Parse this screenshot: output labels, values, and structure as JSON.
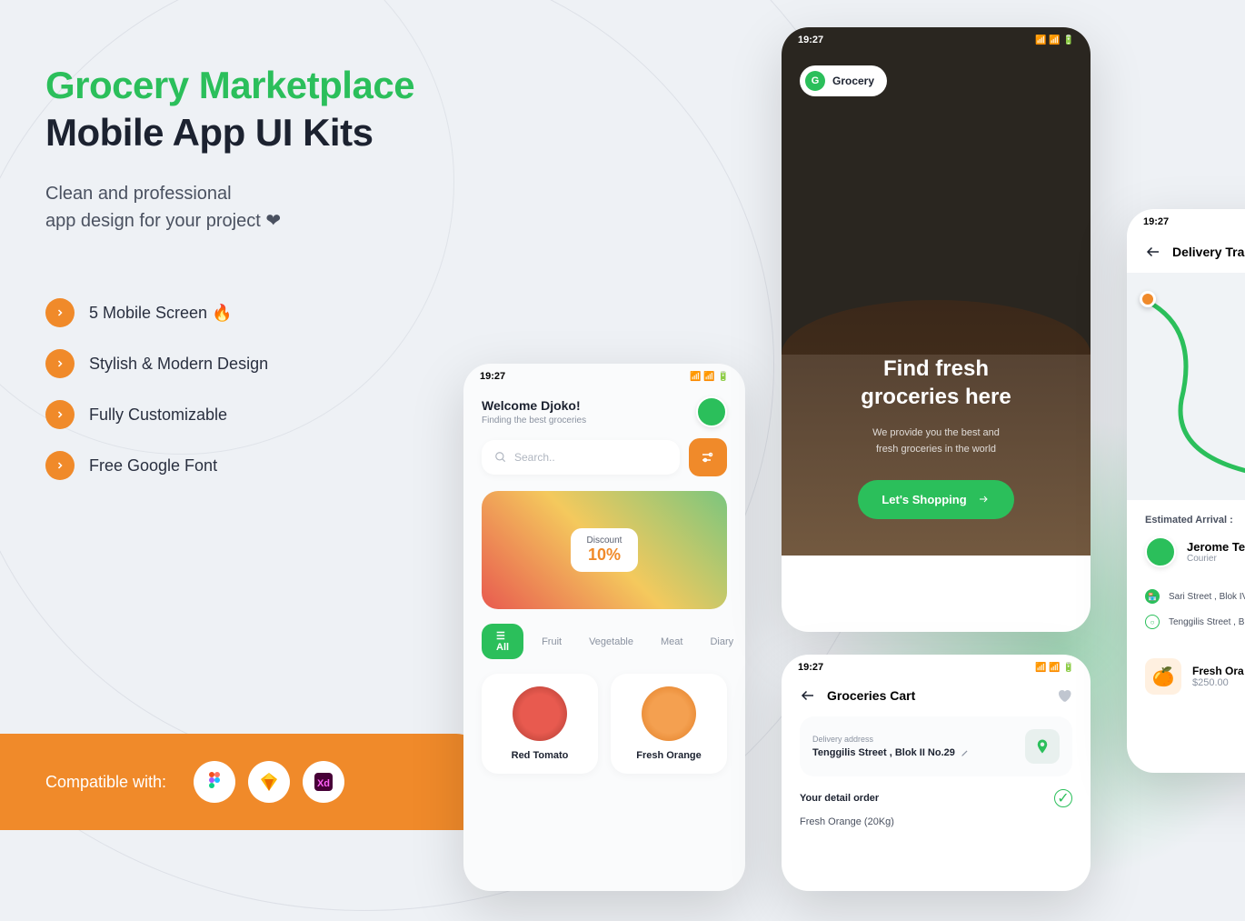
{
  "hero": {
    "title_green": "Grocery Marketplace",
    "title_dark": "Mobile App UI Kits",
    "subtitle_line1": "Clean and professional",
    "subtitle_line2": "app design for your project ❤"
  },
  "features": [
    {
      "text": "5 Mobile Screen 🔥"
    },
    {
      "text": "Stylish & Modern Design"
    },
    {
      "text": "Fully Customizable"
    },
    {
      "text": "Free Google Font"
    }
  ],
  "compat": {
    "label": "Compatible with:",
    "apps": [
      "Figma",
      "Sketch",
      "Adobe XD"
    ]
  },
  "time": "19:27",
  "home": {
    "welcome": "Welcome Djoko!",
    "subtitle": "Finding the best groceries",
    "search_placeholder": "Search..",
    "discount_label": "Discount",
    "discount_value": "10%",
    "tabs": [
      "☰  All",
      "Fruit",
      "Vegetable",
      "Meat",
      "Diary"
    ],
    "products": [
      {
        "name": "Red Tomato",
        "color": "#d94a3a"
      },
      {
        "name": "Fresh Orange",
        "color": "#f08a2a"
      }
    ]
  },
  "onboard": {
    "brand": "Grocery",
    "brand_letter": "G",
    "title_l1": "Find fresh",
    "title_l2": "groceries here",
    "sub_l1": "We provide you the best and",
    "sub_l2": "fresh groceries in the world",
    "cta": "Let's Shopping"
  },
  "cart": {
    "title": "Groceries Cart",
    "addr_label": "Delivery address",
    "addr_value": "Tenggilis Street , Blok II No.29",
    "order_label": "Your detail order",
    "order_item": "Fresh Orange (20Kg)"
  },
  "track": {
    "title": "Delivery Track",
    "est_label": "Estimated Arrival :",
    "courier_name": "Jerome Te",
    "courier_role": "Courier",
    "step1": "Sari Street , Blok IV",
    "step2": "Tenggilis Street , B",
    "item_name": "Fresh Ora",
    "item_price": "$250.00"
  }
}
